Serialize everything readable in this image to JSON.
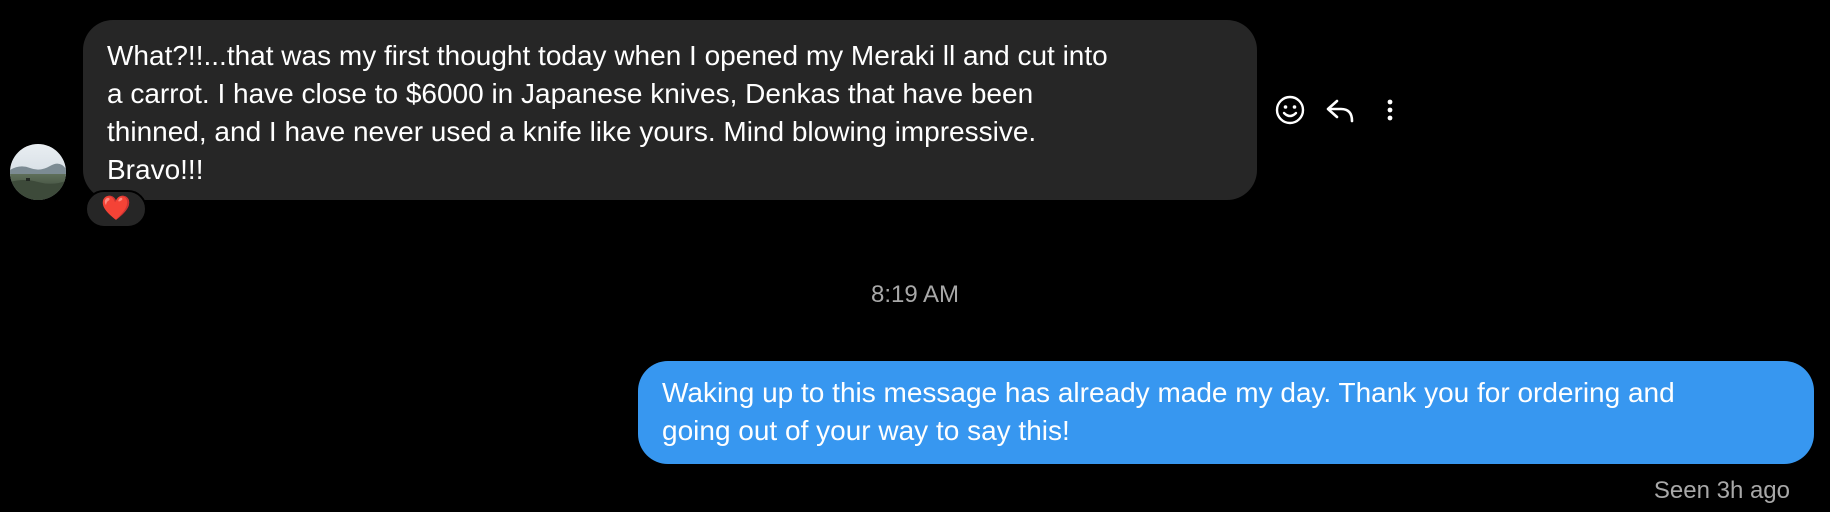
{
  "thread": {
    "incoming_message": {
      "text": "What?!!...that was my first thought today when I opened my Meraki ll and cut into\na carrot.  I have close to $6000 in Japanese knives, Denkas that have been\nthinned, and I have never used a knife like yours.  Mind blowing impressive.\nBravo!!!",
      "reaction": "❤️"
    },
    "message_actions": {
      "react_icon": "smiley-icon",
      "reply_icon": "reply-arrow-icon",
      "more_icon": "more-vertical-icon"
    },
    "timestamp": "8:19 AM",
    "outgoing_message": {
      "text": "Waking up to this message has already made my day. Thank you for ordering and\ngoing out of your way to say this!"
    },
    "seen_status": "Seen 3h ago"
  },
  "colors": {
    "background": "#000000",
    "incoming_bubble": "#262626",
    "outgoing_bubble": "#3797f0",
    "muted_text": "#a8a8a8"
  }
}
